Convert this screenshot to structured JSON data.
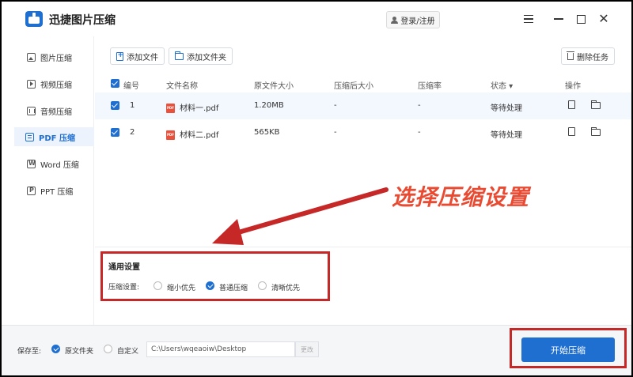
{
  "app": {
    "title": "迅捷图片压缩",
    "login_label": "登录/注册"
  },
  "sidebar": {
    "items": [
      {
        "label": "图片压缩"
      },
      {
        "label": "视频压缩"
      },
      {
        "label": "音频压缩"
      },
      {
        "label": "PDF 压缩"
      },
      {
        "label": "Word 压缩"
      },
      {
        "label": "PPT 压缩"
      }
    ],
    "active": "PDF 压缩"
  },
  "toolbar": {
    "add_file": "添加文件",
    "add_folder": "添加文件夹",
    "delete_task": "删除任务"
  },
  "table": {
    "headers": {
      "index": "编号",
      "name": "文件名称",
      "orig_size": "原文件大小",
      "new_size": "压缩后大小",
      "ratio": "压缩率",
      "status": "状态 ▾",
      "ops": "操作"
    },
    "rows": [
      {
        "index": "1",
        "name": "材料一.pdf",
        "orig_size": "1.20MB",
        "new_size": "-",
        "ratio": "-",
        "status": "等待处理"
      },
      {
        "index": "2",
        "name": "材料二.pdf",
        "orig_size": "565KB",
        "new_size": "-",
        "ratio": "-",
        "status": "等待处理"
      }
    ],
    "pdf_badge": "PDF"
  },
  "annotation": {
    "text": "选择压缩设置"
  },
  "settings": {
    "title": "通用设置",
    "label": "压缩设置:",
    "options": [
      {
        "label": "缩小优先",
        "selected": false
      },
      {
        "label": "普通压缩",
        "selected": true
      },
      {
        "label": "清晰优先",
        "selected": false
      }
    ]
  },
  "footer": {
    "save_to": "保存至:",
    "opt_original": "原文件夹",
    "opt_custom": "自定义",
    "path": "C:\\Users\\wqeaoiw\\Desktop",
    "change": "更改",
    "start": "开始压缩"
  },
  "colors": {
    "accent": "#1f6fd1",
    "annotation": "#e84a32",
    "highlight_box": "#c62828"
  }
}
